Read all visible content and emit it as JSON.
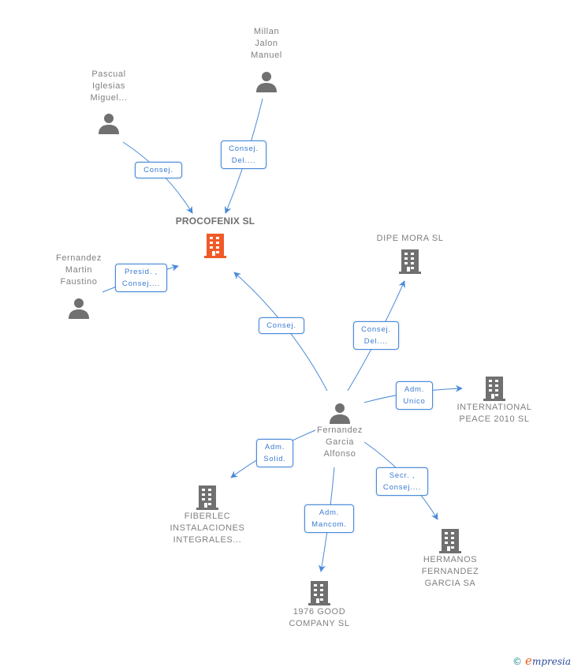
{
  "colors": {
    "edge": "#4a8ad8",
    "center_icon": "#f05a28",
    "node_icon": "#707070",
    "relation_text": "#3a7ad0"
  },
  "center": {
    "name": "PROCOFENIX SL",
    "icon": "building-icon"
  },
  "persons": [
    {
      "id": "millan",
      "name": "Millan\nJalon\nManuel",
      "icon": "person-icon"
    },
    {
      "id": "pascual",
      "name": "Pascual\nIglesias\nMiguel...",
      "icon": "person-icon"
    },
    {
      "id": "martin",
      "name": "Fernandez\nMartin\nFaustino",
      "icon": "person-icon"
    },
    {
      "id": "garcia",
      "name": "Fernandez\nGarcia\nAlfonso",
      "icon": "person-icon"
    }
  ],
  "companies": [
    {
      "id": "dipe",
      "name": "DIPE MORA SL",
      "icon": "building-icon"
    },
    {
      "id": "intl",
      "name": "INTERNATIONAL\nPEACE 2010 SL",
      "icon": "building-icon"
    },
    {
      "id": "fiberlec",
      "name": "FIBERLEC\nINSTALACIONES\nINTEGRALES...",
      "icon": "building-icon"
    },
    {
      "id": "good",
      "name": "1976 GOOD\nCOMPANY SL",
      "icon": "building-icon"
    },
    {
      "id": "hermanos",
      "name": "HERMANOS\nFERNANDEZ\nGARCIA SA",
      "icon": "building-icon"
    }
  ],
  "relations": [
    {
      "from": "pascual",
      "to": "center",
      "label": "Consej."
    },
    {
      "from": "millan",
      "to": "center",
      "label": "Consej.\nDel...."
    },
    {
      "from": "martin",
      "to": "center",
      "label": "Presid. ,\nConsej...."
    },
    {
      "from": "garcia",
      "to": "center",
      "label": "Consej."
    },
    {
      "from": "garcia",
      "to": "dipe",
      "label": "Consej.\nDel...."
    },
    {
      "from": "garcia",
      "to": "intl",
      "label": "Adm.\nUnico"
    },
    {
      "from": "garcia",
      "to": "fiberlec",
      "label": "Adm.\nSolid."
    },
    {
      "from": "garcia",
      "to": "good",
      "label": "Adm.\nMancom."
    },
    {
      "from": "garcia",
      "to": "hermanos",
      "label": "Secr. ,\nConsej...."
    }
  ],
  "footer": {
    "copyright": "©",
    "brand_initial": "e",
    "brand_rest": "mpresia"
  }
}
